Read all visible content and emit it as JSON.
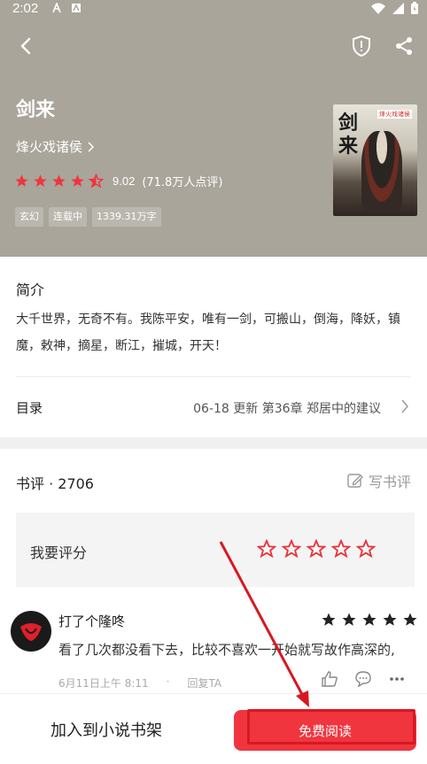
{
  "status_bar": {
    "time": "2:02"
  },
  "book": {
    "title": "剑来",
    "author": "烽火戏诸侯",
    "score": "9.02",
    "rating_count": "(71.8万人点评)",
    "stars_filled": 4.5,
    "tags": [
      "玄幻",
      "连载中",
      "1339.31万字"
    ],
    "cover_title": "剑来",
    "cover_small": "烽火戏诸侯"
  },
  "intro": {
    "label": "简介",
    "description": "大千世界，无奇不有。我陈平安，唯有一剑，可搬山，倒海，降妖，镇魔，敕神，摘星，断江，摧城，开天！"
  },
  "toc": {
    "label": "目录",
    "info": "06-18  更新  第36章 郑居中的建议"
  },
  "reviews": {
    "title": "书评 · 2706",
    "write_label": "写书评",
    "rate_label": "我要评分",
    "comment": {
      "name": "打了个隆咚",
      "text": "看了几次都没看下去，比较不喜欢一开始就写故作高深的,",
      "time": "6月11日上午 8:11",
      "reply": "回复TA",
      "stars": 5
    }
  },
  "bottom": {
    "add_shelf": "加入到小说书架",
    "read": "免费阅读"
  },
  "colors": {
    "header_bg": "#a9a59a",
    "accent_red": "#f0353f",
    "annotation_red": "#d81820"
  }
}
